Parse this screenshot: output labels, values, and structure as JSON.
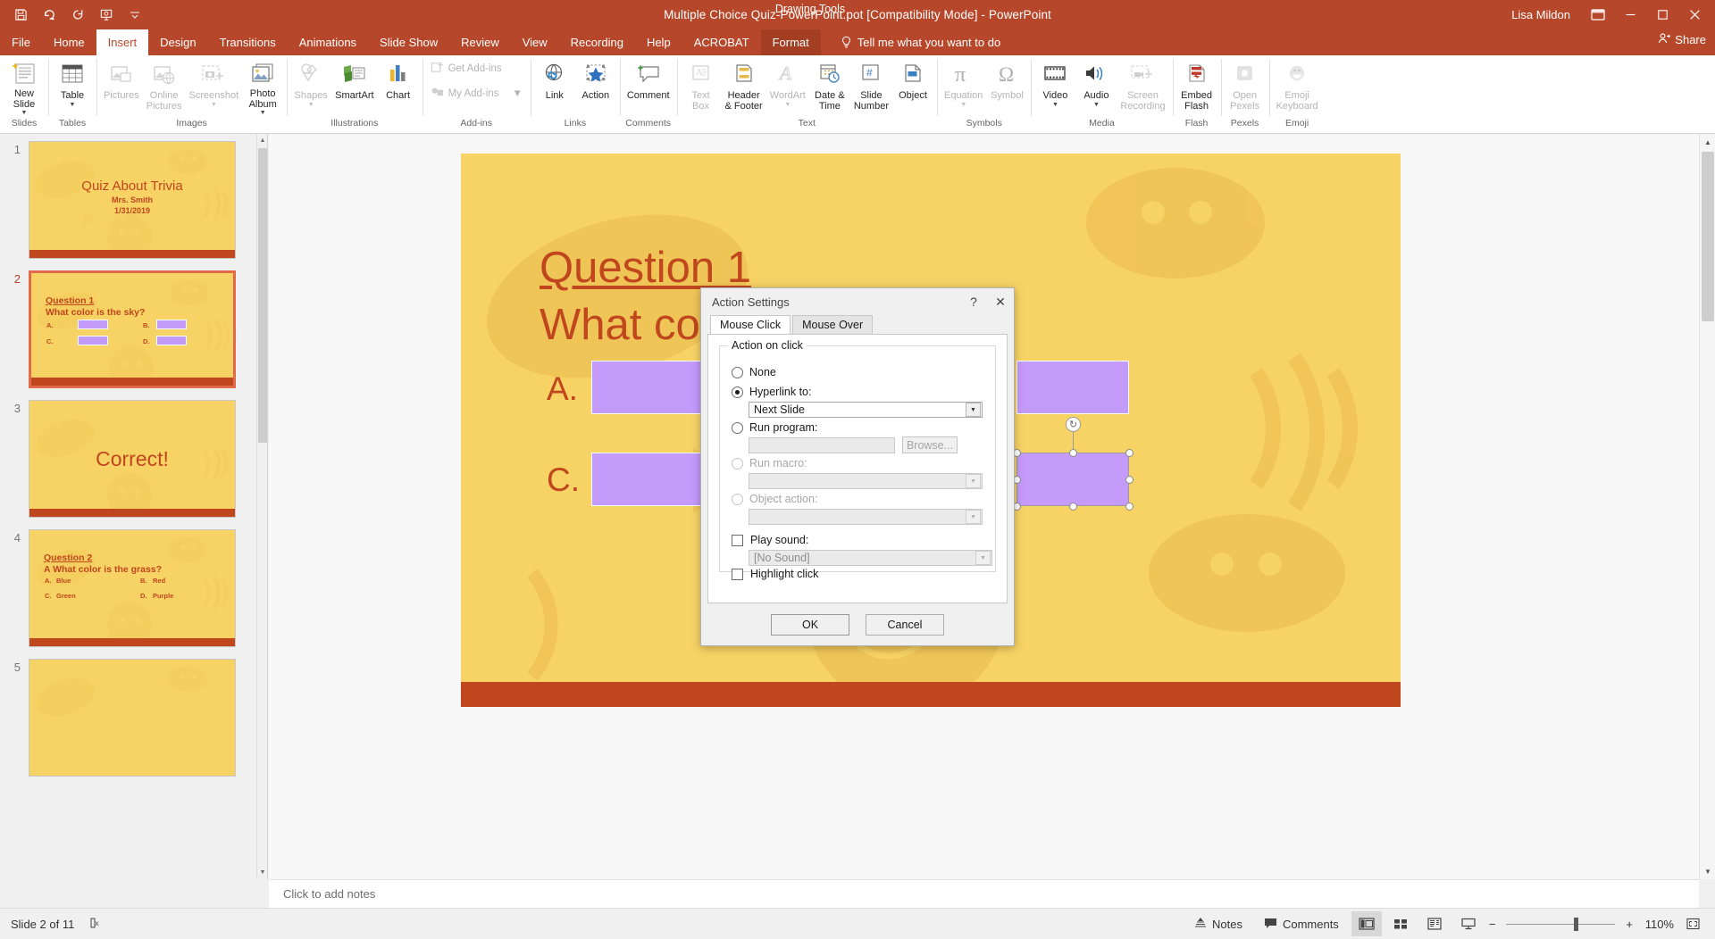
{
  "titlebar": {
    "document_title": "Multiple Choice Quiz-PowerPoint.pot [Compatibility Mode]  -  PowerPoint",
    "user_name": "Lisa Mildon",
    "contextual_tab_label": "Drawing Tools",
    "qat": [
      "save-icon",
      "undo-icon",
      "redo-icon",
      "start-presentation-icon",
      "customize-qat-icon"
    ],
    "window_buttons": [
      "ribbon-display-options",
      "minimize",
      "restore",
      "close"
    ]
  },
  "tabs": [
    {
      "label": "File",
      "active": false,
      "kind": "file"
    },
    {
      "label": "Home",
      "active": false,
      "kind": "normal"
    },
    {
      "label": "Insert",
      "active": true,
      "kind": "normal"
    },
    {
      "label": "Design",
      "active": false,
      "kind": "normal"
    },
    {
      "label": "Transitions",
      "active": false,
      "kind": "normal"
    },
    {
      "label": "Animations",
      "active": false,
      "kind": "normal"
    },
    {
      "label": "Slide Show",
      "active": false,
      "kind": "normal"
    },
    {
      "label": "Review",
      "active": false,
      "kind": "normal"
    },
    {
      "label": "View",
      "active": false,
      "kind": "normal"
    },
    {
      "label": "Recording",
      "active": false,
      "kind": "normal"
    },
    {
      "label": "Help",
      "active": false,
      "kind": "normal"
    },
    {
      "label": "ACROBAT",
      "active": false,
      "kind": "normal"
    },
    {
      "label": "Format",
      "active": false,
      "kind": "contextual"
    }
  ],
  "tellme": {
    "label": "Tell me what you want to do",
    "icon": "lightbulb-icon"
  },
  "share": {
    "label": "Share",
    "icon": "share-person-icon"
  },
  "ribbon": {
    "groups": [
      {
        "label": "Slides",
        "buttons": [
          {
            "label": "New\nSlide",
            "icon": "new-slide-icon",
            "disabled": false,
            "dropdown": true
          }
        ]
      },
      {
        "label": "Tables",
        "buttons": [
          {
            "label": "Table",
            "icon": "table-icon",
            "disabled": false,
            "dropdown": true
          }
        ]
      },
      {
        "label": "Images",
        "buttons": [
          {
            "label": "Pictures",
            "icon": "pictures-icon",
            "disabled": true,
            "dropdown": false
          },
          {
            "label": "Online\nPictures",
            "icon": "online-pictures-icon",
            "disabled": true,
            "dropdown": false
          },
          {
            "label": "Screenshot",
            "icon": "screenshot-icon",
            "disabled": true,
            "dropdown": true
          },
          {
            "label": "Photo\nAlbum",
            "icon": "photo-album-icon",
            "disabled": false,
            "dropdown": true
          }
        ]
      },
      {
        "label": "Illustrations",
        "buttons": [
          {
            "label": "Shapes",
            "icon": "shapes-icon",
            "disabled": true,
            "dropdown": true
          },
          {
            "label": "SmartArt",
            "icon": "smartart-icon",
            "disabled": false,
            "dropdown": false
          },
          {
            "label": "Chart",
            "icon": "chart-icon",
            "disabled": false,
            "dropdown": false
          }
        ]
      },
      {
        "label": "Add-ins",
        "small_buttons": [
          {
            "label": "Get Add-ins",
            "icon": "get-addins-icon",
            "disabled": true
          },
          {
            "label": "My Add-ins",
            "icon": "my-addins-icon",
            "disabled": true,
            "dropdown": true
          }
        ]
      },
      {
        "label": "Links",
        "buttons": [
          {
            "label": "Link",
            "icon": "link-icon",
            "disabled": false,
            "dropdown": false
          },
          {
            "label": "Action",
            "icon": "action-icon",
            "disabled": false,
            "dropdown": false
          }
        ]
      },
      {
        "label": "Comments",
        "buttons": [
          {
            "label": "Comment",
            "icon": "comment-icon",
            "disabled": false,
            "dropdown": false
          }
        ]
      },
      {
        "label": "Text",
        "buttons": [
          {
            "label": "Text\nBox",
            "icon": "text-box-icon",
            "disabled": true,
            "dropdown": false
          },
          {
            "label": "Header\n& Footer",
            "icon": "header-footer-icon",
            "disabled": false,
            "dropdown": false
          },
          {
            "label": "WordArt",
            "icon": "wordart-icon",
            "disabled": true,
            "dropdown": true
          },
          {
            "label": "Date &\nTime",
            "icon": "date-time-icon",
            "disabled": false,
            "dropdown": false
          },
          {
            "label": "Slide\nNumber",
            "icon": "slide-number-icon",
            "disabled": false,
            "dropdown": false
          },
          {
            "label": "Object",
            "icon": "object-icon",
            "disabled": false,
            "dropdown": false
          }
        ]
      },
      {
        "label": "Symbols",
        "buttons": [
          {
            "label": "Equation",
            "icon": "equation-icon",
            "disabled": true,
            "dropdown": true
          },
          {
            "label": "Symbol",
            "icon": "symbol-icon",
            "disabled": true,
            "dropdown": false
          }
        ]
      },
      {
        "label": "Media",
        "buttons": [
          {
            "label": "Video",
            "icon": "video-icon",
            "disabled": false,
            "dropdown": true
          },
          {
            "label": "Audio",
            "icon": "audio-icon",
            "disabled": false,
            "dropdown": true
          },
          {
            "label": "Screen\nRecording",
            "icon": "screen-recording-icon",
            "disabled": true,
            "dropdown": false
          }
        ]
      },
      {
        "label": "Flash",
        "buttons": [
          {
            "label": "Embed\nFlash",
            "icon": "embed-flash-icon",
            "disabled": false,
            "dropdown": false
          }
        ]
      },
      {
        "label": "Pexels",
        "buttons": [
          {
            "label": "Open\nPexels",
            "icon": "open-pexels-icon",
            "disabled": true,
            "dropdown": false
          }
        ]
      },
      {
        "label": "Emoji",
        "buttons": [
          {
            "label": "Emoji\nKeyboard",
            "icon": "emoji-keyboard-icon",
            "disabled": true,
            "dropdown": false
          }
        ]
      }
    ]
  },
  "thumbnails": [
    {
      "number": "1",
      "selected": false,
      "type": "title",
      "title": "Quiz About Trivia",
      "author": "Mrs. Smith",
      "date": "1/31/2019"
    },
    {
      "number": "2",
      "selected": true,
      "type": "question",
      "question_label": "Question 1",
      "question_text": "What color is the sky?",
      "options": [
        {
          "letter": "A.",
          "text": ""
        },
        {
          "letter": "B.",
          "text": ""
        },
        {
          "letter": "C.",
          "text": ""
        },
        {
          "letter": "D.",
          "text": ""
        }
      ]
    },
    {
      "number": "3",
      "selected": false,
      "type": "message",
      "message": "Correct!"
    },
    {
      "number": "4",
      "selected": false,
      "type": "question",
      "question_label": "Question 2",
      "question_text": "A What color is the grass?",
      "options": [
        {
          "letter": "A.",
          "text": "Blue"
        },
        {
          "letter": "B.",
          "text": "Red"
        },
        {
          "letter": "C.",
          "text": "Green"
        },
        {
          "letter": "D.",
          "text": "Purple"
        }
      ]
    },
    {
      "number": "5",
      "selected": false,
      "type": "blank"
    }
  ],
  "slide": {
    "question_label": "Question 1",
    "question_text": "What color is the sky?",
    "options": [
      {
        "letter": "A."
      },
      {
        "letter": "B."
      },
      {
        "letter": "C."
      },
      {
        "letter": "D."
      }
    ],
    "selected_shape": "option-d-box"
  },
  "notes": {
    "placeholder": "Click to add notes"
  },
  "statusbar": {
    "slide_counter": "Slide 2 of 11",
    "accessibility_icon": "accessibility-checker-icon",
    "notes_label": "Notes",
    "notes_icon": "notes-icon",
    "comments_label": "Comments",
    "comments_icon": "comment-bubble-icon",
    "views": [
      {
        "name": "normal-view",
        "active": true
      },
      {
        "name": "slide-sorter-view",
        "active": false
      },
      {
        "name": "reading-view",
        "active": false
      },
      {
        "name": "slide-show-view",
        "active": false
      }
    ],
    "zoom_out": "−",
    "zoom_in": "+",
    "zoom_level": "110%",
    "fit_slide_icon": "fit-to-window-icon"
  },
  "dialog": {
    "title": "Action Settings",
    "help_button": "?",
    "close_button": "✕",
    "tabs": [
      {
        "label": "Mouse Click",
        "active": true
      },
      {
        "label": "Mouse Over",
        "active": false
      }
    ],
    "group_label": "Action on click",
    "options": {
      "none": {
        "label": "None",
        "mnemonic": "N",
        "selected": false,
        "disabled": false
      },
      "hyperlink": {
        "label": "Hyperlink to:",
        "mnemonic": "H",
        "selected": true,
        "disabled": false,
        "value": "Next Slide"
      },
      "run_program": {
        "label": "Run program:",
        "mnemonic": "R",
        "selected": false,
        "disabled": false,
        "value": "",
        "browse_label": "Browse..."
      },
      "run_macro": {
        "label": "Run macro:",
        "mnemonic": "m",
        "selected": false,
        "disabled": true,
        "value": ""
      },
      "object_action": {
        "label": "Object action:",
        "mnemonic": "a",
        "selected": false,
        "disabled": true,
        "value": ""
      }
    },
    "play_sound": {
      "label": "Play sound:",
      "mnemonic": "P",
      "checked": false,
      "value": "[No Sound]"
    },
    "highlight_click": {
      "label": "Highlight click",
      "mnemonic": "c",
      "checked": false
    },
    "ok_label": "OK",
    "cancel_label": "Cancel"
  },
  "colors": {
    "brand": "#b7472a",
    "slide_bg": "#f7d265",
    "slide_accent": "#c0461e",
    "option_box": "#c49afa",
    "selection_border": "#e06a4a"
  }
}
